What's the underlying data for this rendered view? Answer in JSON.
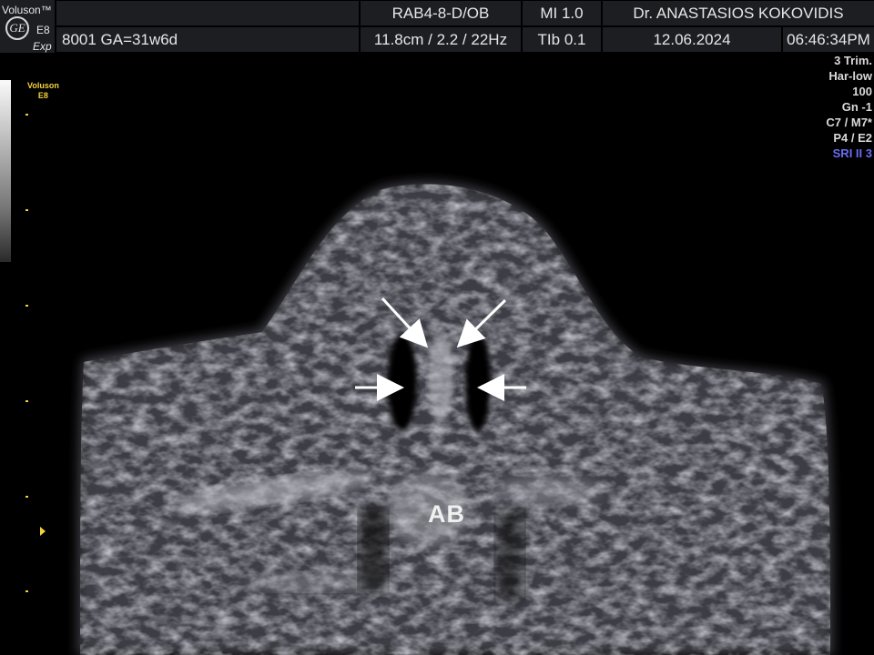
{
  "header": {
    "brand": "Voluson™",
    "logo_text": "GE",
    "model": "E8",
    "mode_tag": "Exp",
    "patient_info": "8001  GA=31w6d",
    "probe": "RAB4-8-D/OB",
    "mi": "MI  1.0",
    "physician": "Dr. ANASTASIOS KOKOVIDIS",
    "depth_freq": "11.8cm / 2.2 / 22Hz",
    "tib": "TIb  0.1",
    "date": "12.06.2024",
    "time": "06:46:34PM"
  },
  "params": {
    "trimester": "3 Trim.",
    "harmonic": "Har-low",
    "power": "100",
    "gain": "Gn  -1",
    "map": "C7 / M7*",
    "persistence": "P4 / E2",
    "sri": "SRI II 3"
  },
  "side_logo": {
    "line1": "Voluson",
    "line2": "E8"
  },
  "image": {
    "annotation": "AB"
  },
  "colors": {
    "accent_yellow": "#f4d23c",
    "sri_blue": "#6a6cf2",
    "header_bg": "#1c1e22"
  }
}
